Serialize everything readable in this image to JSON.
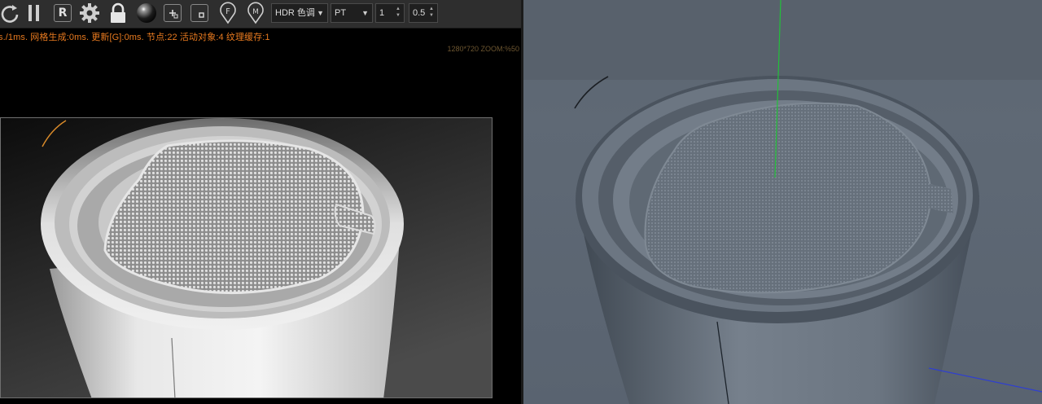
{
  "toolbar": {
    "icons": [
      "refresh-icon",
      "pause-icon",
      "region-render-icon",
      "settings-gear-icon",
      "lock-icon",
      "material-sphere-icon",
      "add-region-icon",
      "object-region-icon",
      "filter-pin-icon",
      "material-pin-icon"
    ],
    "region_label": "R",
    "pin_f_label": "F",
    "pin_m_label": "M",
    "tone_select": "HDR 色调",
    "camera_select": "PT",
    "samples_value": "1",
    "ratio_value": "0.5"
  },
  "status": {
    "line": "s./1ms. 网格生成:0ms. 更新[G]:0ms. 节点:22 活动对象:4 纹理缓存:1",
    "resolution": "1280*720 ZOOM:%50"
  },
  "colors": {
    "toolbar_bg": "#2e2e2e",
    "status_text": "#e87a1f",
    "viewport_bg": "#5e6874",
    "y_axis": "#22c03a",
    "x_axis": "#2f3fd0"
  }
}
